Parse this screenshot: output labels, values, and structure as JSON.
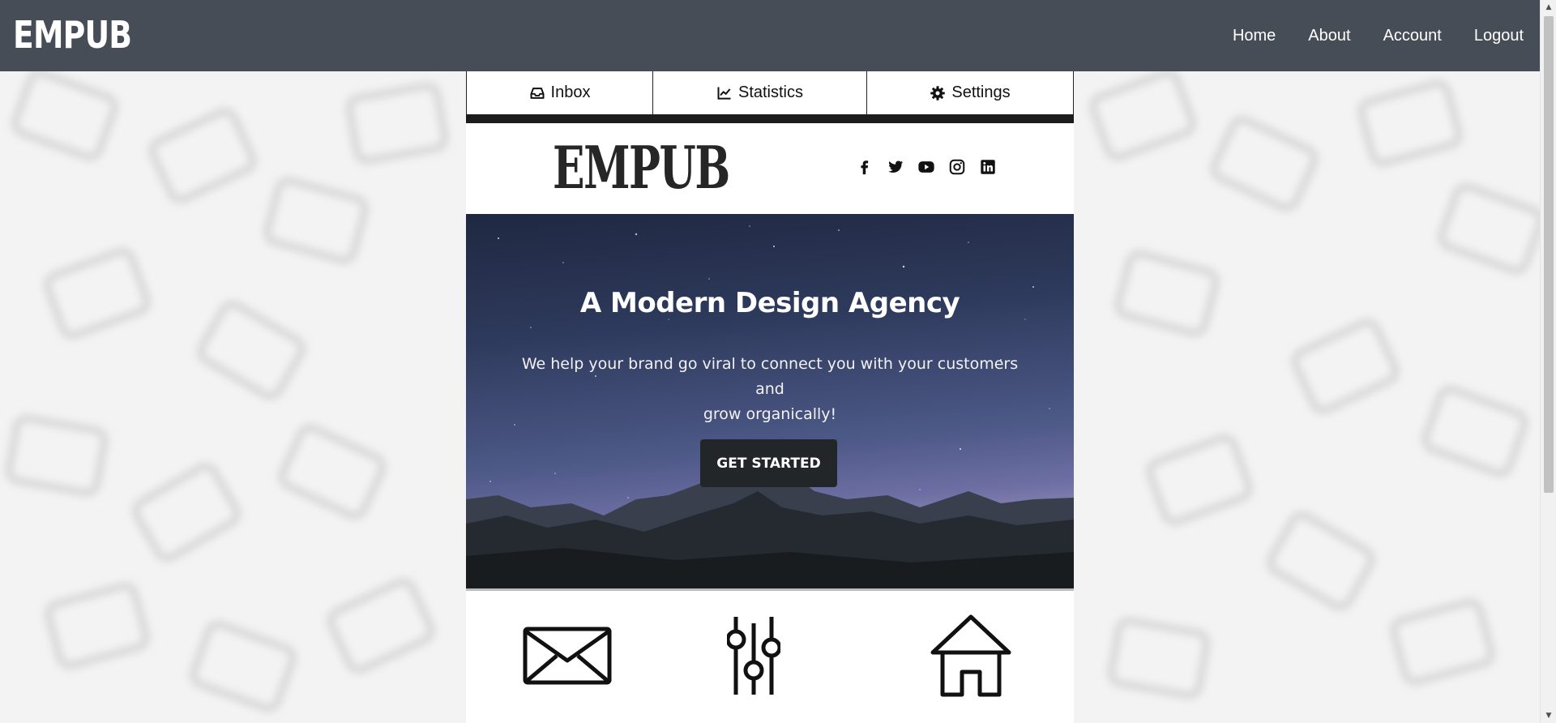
{
  "navbar": {
    "brand": "EMPUB",
    "links": [
      "Home",
      "About",
      "Account",
      "Logout"
    ]
  },
  "tabs": [
    {
      "label": "Inbox",
      "icon": "inbox-icon"
    },
    {
      "label": "Statistics",
      "icon": "chart-line-icon"
    },
    {
      "label": "Settings",
      "icon": "gear-icon"
    }
  ],
  "email": {
    "logo": "EMPUB",
    "social_icons": [
      "facebook-icon",
      "twitter-icon",
      "youtube-icon",
      "instagram-icon",
      "linkedin-icon"
    ],
    "hero": {
      "title": "A Modern Design Agency",
      "text_line1": "We help your brand go viral to connect you with your customers and",
      "text_line2": "grow organically!",
      "button": "GET STARTED"
    },
    "feature_icons": [
      "envelope-icon",
      "sliders-icon",
      "house-icon"
    ]
  },
  "colors": {
    "navbar_bg": "#474d56",
    "button_bg": "#232629"
  }
}
